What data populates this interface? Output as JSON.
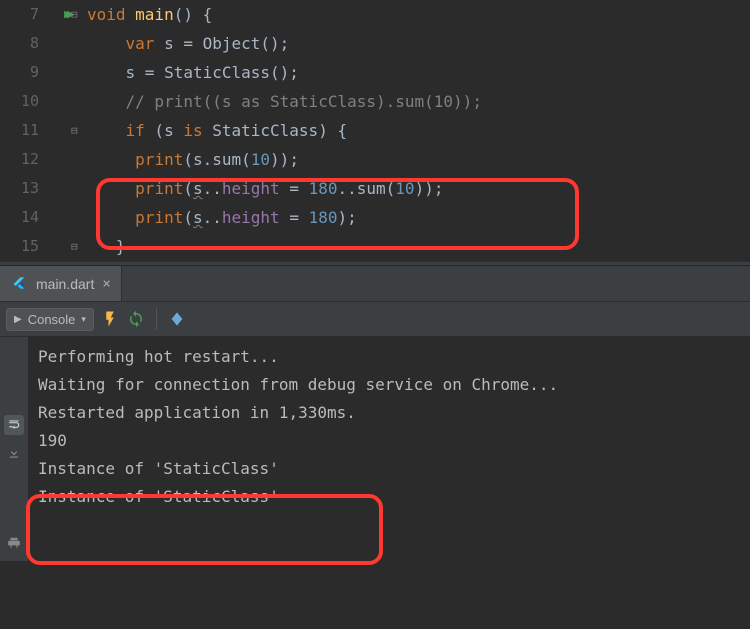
{
  "editor": {
    "lines": [
      {
        "num": "7",
        "gutter": "run",
        "fold": "open",
        "tokens": [
          {
            "t": "kw",
            "v": "void "
          },
          {
            "t": "fn",
            "v": "main"
          },
          {
            "t": "id",
            "v": "() {"
          }
        ]
      },
      {
        "num": "8",
        "tokens": [
          {
            "t": "id",
            "v": "    "
          },
          {
            "t": "kw",
            "v": "var"
          },
          {
            "t": "id",
            "v": " s = Object();"
          }
        ]
      },
      {
        "num": "9",
        "tokens": [
          {
            "t": "id",
            "v": "    s = StaticClass();"
          }
        ]
      },
      {
        "num": "10",
        "tokens": [
          {
            "t": "id",
            "v": "    "
          },
          {
            "t": "cm",
            "v": "// print((s as StaticClass).sum(10));"
          }
        ]
      },
      {
        "num": "11",
        "fold": "open",
        "tokens": [
          {
            "t": "id",
            "v": "    "
          },
          {
            "t": "kw",
            "v": "if"
          },
          {
            "t": "id",
            "v": " (s "
          },
          {
            "t": "kw",
            "v": "is"
          },
          {
            "t": "id",
            "v": " StaticClass) {"
          }
        ]
      },
      {
        "num": "12",
        "tokens": [
          {
            "t": "id",
            "v": "     "
          },
          {
            "t": "pr",
            "v": "print"
          },
          {
            "t": "id",
            "v": "(s.sum("
          },
          {
            "t": "num",
            "v": "10"
          },
          {
            "t": "id",
            "v": "));"
          }
        ]
      },
      {
        "num": "13",
        "tokens": [
          {
            "t": "id",
            "v": "     "
          },
          {
            "t": "pr",
            "v": "print"
          },
          {
            "t": "id",
            "v": "("
          },
          {
            "t": "wavy",
            "v": "s"
          },
          {
            "t": "id",
            "v": ".."
          },
          {
            "t": "prop",
            "v": "height"
          },
          {
            "t": "id",
            "v": " = "
          },
          {
            "t": "num",
            "v": "180"
          },
          {
            "t": "id",
            "v": "..sum("
          },
          {
            "t": "num",
            "v": "10"
          },
          {
            "t": "id",
            "v": "));"
          }
        ]
      },
      {
        "num": "14",
        "tokens": [
          {
            "t": "id",
            "v": "     "
          },
          {
            "t": "pr",
            "v": "print"
          },
          {
            "t": "id",
            "v": "("
          },
          {
            "t": "wavy",
            "v": "s"
          },
          {
            "t": "id",
            "v": ".."
          },
          {
            "t": "prop",
            "v": "height"
          },
          {
            "t": "id",
            "v": " = "
          },
          {
            "t": "num",
            "v": "180"
          },
          {
            "t": "id",
            "v": ");"
          }
        ]
      },
      {
        "num": "15",
        "fold": "close",
        "tokens": [
          {
            "t": "id",
            "v": "   }"
          }
        ]
      }
    ]
  },
  "tab": {
    "filename": "main.dart"
  },
  "toolbar": {
    "console_label": "Console"
  },
  "console": {
    "lines": [
      "Performing hot restart...",
      "Waiting for connection from debug service on Chrome...",
      "Restarted application in 1,330ms.",
      "190",
      "Instance of 'StaticClass'",
      "Instance of 'StaticClass'"
    ]
  }
}
